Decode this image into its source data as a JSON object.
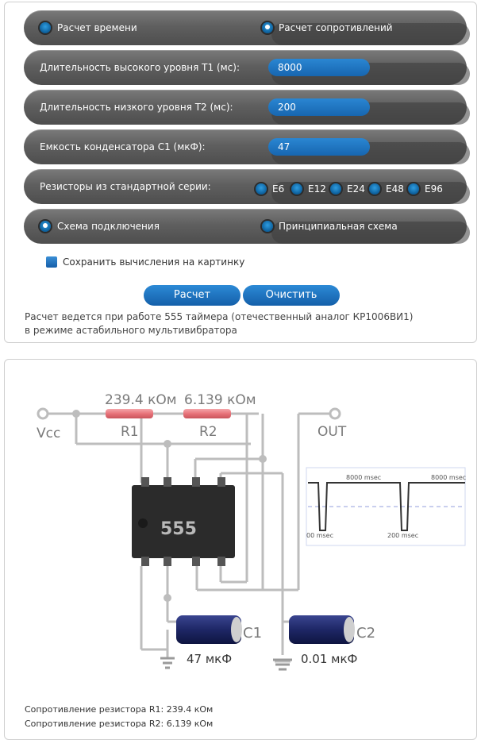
{
  "mode_row": {
    "option_time": "Расчет времени",
    "option_resistors": "Расчет сопротивлений",
    "selected": "resistors"
  },
  "t1": {
    "label": "Длительность высокого уровня T1 (мс):",
    "value": "8000"
  },
  "t2": {
    "label": "Длительность низкого уровня T2 (мс):",
    "value": "200"
  },
  "c1": {
    "label": "Емкость конденсатора C1 (мкФ):",
    "value": "47"
  },
  "series": {
    "label": "Резисторы из стандартной серии:",
    "options": [
      "E6",
      "E12",
      "E24",
      "E48",
      "E96"
    ]
  },
  "scheme": {
    "option_wiring": "Схема подключения",
    "option_principal": "Принципиальная схема",
    "selected": "wiring"
  },
  "save_label": "Сохранить вычисления на картинку",
  "buttons": {
    "calc": "Расчет",
    "clear": "Очистить"
  },
  "note": "Расчет ведется при работе 555 таймера (отечественный аналог КР1006ВИ1) в режиме астабильного мультивибратора",
  "diagram": {
    "r1_value": "239.4 кОм",
    "r2_value": "6.139 кОм",
    "r1_name": "R1",
    "r2_name": "R2",
    "vcc": "Vcc",
    "out": "OUT",
    "chip": "555",
    "c1_name": "C1",
    "c2_name": "C2",
    "c1_value": "47 мкФ",
    "c2_value": "0.01 мкФ",
    "wave_high1": "8000 msec",
    "wave_high2": "8000 msec",
    "wave_low1": "00 msec",
    "wave_low2": "200 msec"
  },
  "results": {
    "r1": "Сопротивление резистора R1: 239.4 кОм",
    "r2": "Сопротивление резистора R2: 6.139 кОм"
  },
  "colors": {
    "accent": "#1f78c8",
    "row_bg": "#5f5f5f",
    "resistor": "#e8737a",
    "capacitor": "#1e2766",
    "wire": "#bdbdbd"
  }
}
